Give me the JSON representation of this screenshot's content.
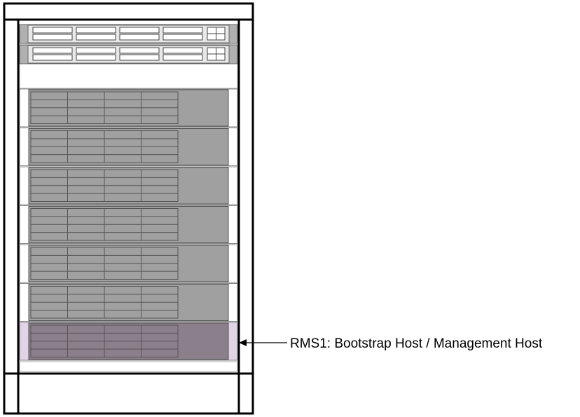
{
  "annotation": {
    "label": "RMS1:  Bootstrap Host / Management Host"
  },
  "rack": {
    "switches": [
      {
        "ports": 4,
        "has_grid_port": true
      },
      {
        "ports": 4,
        "has_grid_port": true
      }
    ],
    "servers": [
      {
        "highlighted": false
      },
      {
        "highlighted": false
      },
      {
        "highlighted": false
      },
      {
        "highlighted": false
      },
      {
        "highlighted": false
      },
      {
        "highlighted": false
      },
      {
        "highlighted": true
      }
    ]
  },
  "colors": {
    "frame": "#000000",
    "switch_ear": "#b0b0b0",
    "switch_face": "#e8e8e8",
    "server_face": "#a0a0a0",
    "server_panel": "#9a9a9a",
    "server_highlight_face": "#8c7f8c",
    "server_highlight_ear": "#e0d4e6",
    "drive_line": "#555555"
  }
}
